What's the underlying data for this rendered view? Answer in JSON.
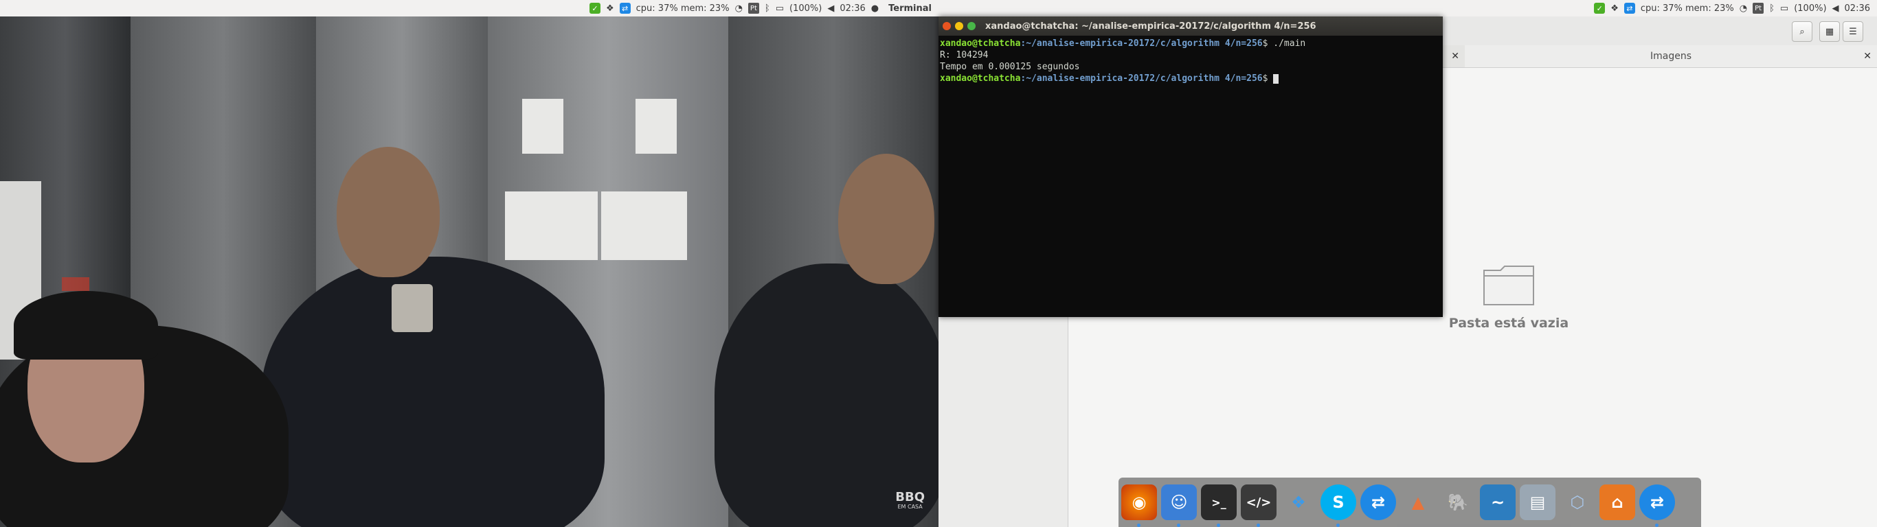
{
  "menubar": {
    "cpu_mem": "cpu: 37% mem: 23%",
    "lang": "Pt",
    "battery": "(100%)",
    "time": "02:36",
    "app_name": "Terminal"
  },
  "video": {
    "watermark_main": "BBQ",
    "watermark_sub": "EM CASA"
  },
  "terminal": {
    "title": "xandao@tchatcha: ~/analise-empirica-20172/c/algorithm 4/n=256",
    "lines": [
      {
        "user": "xandao@tchatcha",
        "path": ":~/analise-empirica-20172/c/algorithm 4/n=256",
        "cmd": "$ ./main"
      },
      {
        "text": "R: 104294"
      },
      {
        "text": "Tempo em 0.000125 segundos"
      },
      {
        "user": "xandao@tchatcha",
        "path": ":~/analise-empirica-20172/c/algorithm 4/n=256",
        "cmd": "$ "
      }
    ]
  },
  "filemanager": {
    "tab_title": "Imagens",
    "empty_text": "Pasta está vazia"
  },
  "dock": {
    "apps": [
      "firefox",
      "finder",
      "terminal",
      "code-editor",
      "dropbox",
      "skype",
      "teamviewer",
      "matlab",
      "postgresql",
      "mysql-workbench",
      "scanner",
      "virtualbox",
      "ubuntu-software",
      "teamviewer-2"
    ]
  },
  "colors": {
    "prompt_user": "#8ae234",
    "prompt_path": "#729fcf",
    "menubar_bg": "#f2f1f0"
  }
}
